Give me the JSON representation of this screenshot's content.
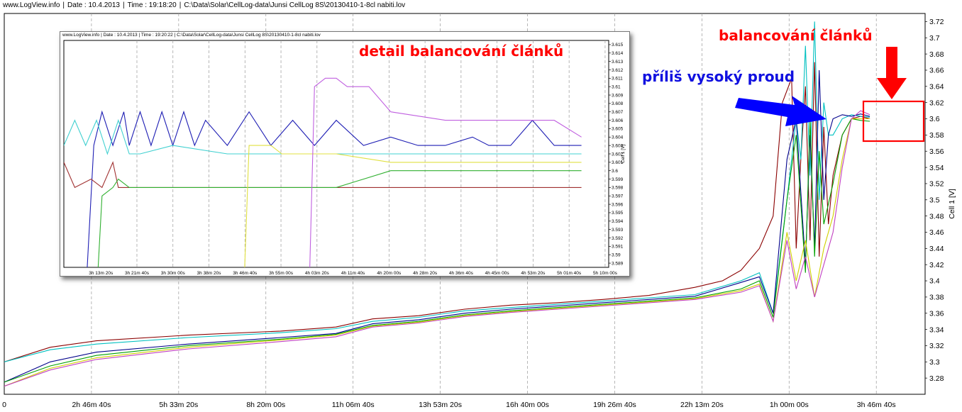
{
  "header": {
    "site": "www.LogView.info",
    "date": "Date : 10.4.2013",
    "time": "Time : 19:18:20",
    "path": "C:\\Data\\Solar\\CellLog-data\\Junsi CellLog 8S\\20130410-1-8cl nabiti.lov"
  },
  "annotations": {
    "detail": "detail balancování článků",
    "high_current": "příliš vysoký proud",
    "balancing": "balancování článků",
    "annotation_color": "#ff0000",
    "arrow_blue": "#0000ff"
  },
  "chart_data": [
    {
      "type": "line",
      "ylabel": "Cell 1 [V]",
      "ylim": [
        3.26,
        3.73
      ],
      "y_ticks": [
        "3.28",
        "3.3",
        "3.32",
        "3.34",
        "3.36",
        "3.38",
        "3.4",
        "3.42",
        "3.44",
        "3.46",
        "3.48",
        "3.5",
        "3.52",
        "3.54",
        "3.56",
        "3.58",
        "3.6",
        "3.62",
        "3.64",
        "3.66",
        "3.68",
        "3.7",
        "3.72"
      ],
      "x_ticks": [
        "0",
        "2h 46m 40s",
        "5h 33m 20s",
        "8h 20m 00s",
        "11h 06m 40s",
        "13h 53m 20s",
        "16h 40m 00s",
        "19h 26m 40s",
        "22h 13m 20s",
        "1h 00m 00s",
        "3h 46m 40s"
      ],
      "grid": true,
      "series": [
        {
          "color": "#8b0000",
          "x": [
            0,
            0.05,
            0.1,
            0.2,
            0.3,
            0.36,
            0.4,
            0.45,
            0.5,
            0.55,
            0.6,
            0.65,
            0.7,
            0.75,
            0.78,
            0.8,
            0.82,
            0.835,
            0.845,
            0.855,
            0.86,
            0.865,
            0.87,
            0.875,
            0.88,
            0.885,
            0.89,
            0.895,
            0.9,
            0.91,
            0.92,
            0.93,
            0.94
          ],
          "y": [
            3.3,
            3.318,
            3.326,
            3.333,
            3.338,
            3.343,
            3.353,
            3.357,
            3.365,
            3.37,
            3.373,
            3.377,
            3.382,
            3.392,
            3.4,
            3.413,
            3.44,
            3.48,
            3.62,
            3.65,
            3.44,
            3.55,
            3.64,
            3.45,
            3.67,
            3.43,
            3.59,
            3.47,
            3.53,
            3.58,
            3.6,
            3.603,
            3.6
          ]
        },
        {
          "color": "#00c0c0",
          "x": [
            0,
            0.05,
            0.1,
            0.2,
            0.3,
            0.36,
            0.4,
            0.45,
            0.5,
            0.55,
            0.6,
            0.65,
            0.7,
            0.75,
            0.8,
            0.82,
            0.835,
            0.85,
            0.86,
            0.865,
            0.87,
            0.875,
            0.88,
            0.885,
            0.89,
            0.895,
            0.9,
            0.91,
            0.92,
            0.93,
            0.94
          ],
          "y": [
            3.3,
            3.315,
            3.322,
            3.33,
            3.336,
            3.341,
            3.35,
            3.355,
            3.363,
            3.367,
            3.371,
            3.375,
            3.379,
            3.383,
            3.4,
            3.41,
            3.36,
            3.5,
            3.6,
            3.55,
            3.69,
            3.53,
            3.72,
            3.5,
            3.62,
            3.58,
            3.58,
            3.6,
            3.605,
            3.603,
            3.602
          ]
        },
        {
          "color": "#00008b",
          "x": [
            0,
            0.05,
            0.1,
            0.2,
            0.3,
            0.36,
            0.4,
            0.45,
            0.5,
            0.55,
            0.6,
            0.65,
            0.7,
            0.75,
            0.8,
            0.82,
            0.835,
            0.85,
            0.86,
            0.87,
            0.875,
            0.88,
            0.885,
            0.89,
            0.895,
            0.9,
            0.91,
            0.92,
            0.93,
            0.94
          ],
          "y": [
            3.275,
            3.3,
            3.312,
            3.322,
            3.33,
            3.335,
            3.347,
            3.352,
            3.36,
            3.365,
            3.369,
            3.373,
            3.377,
            3.381,
            3.398,
            3.405,
            3.36,
            3.55,
            3.6,
            3.42,
            3.58,
            3.44,
            3.66,
            3.5,
            3.58,
            3.6,
            3.605,
            3.603,
            3.606,
            3.603
          ]
        },
        {
          "color": "#00a000",
          "x": [
            0,
            0.05,
            0.1,
            0.2,
            0.3,
            0.36,
            0.4,
            0.45,
            0.5,
            0.55,
            0.6,
            0.65,
            0.7,
            0.75,
            0.8,
            0.82,
            0.835,
            0.85,
            0.86,
            0.87,
            0.875,
            0.88,
            0.885,
            0.89,
            0.9,
            0.91,
            0.92,
            0.93,
            0.94
          ],
          "y": [
            3.275,
            3.295,
            3.308,
            3.32,
            3.328,
            3.334,
            3.345,
            3.35,
            3.358,
            3.363,
            3.367,
            3.371,
            3.375,
            3.379,
            3.39,
            3.4,
            3.355,
            3.5,
            3.58,
            3.41,
            3.6,
            3.43,
            3.56,
            3.47,
            3.52,
            3.58,
            3.6,
            3.598,
            3.597
          ]
        },
        {
          "color": "#d0d000",
          "x": [
            0,
            0.05,
            0.1,
            0.2,
            0.3,
            0.36,
            0.4,
            0.45,
            0.5,
            0.55,
            0.6,
            0.65,
            0.7,
            0.75,
            0.8,
            0.82,
            0.835,
            0.85,
            0.86,
            0.87,
            0.88,
            0.89,
            0.9,
            0.91,
            0.92,
            0.93,
            0.94
          ],
          "y": [
            3.27,
            3.292,
            3.305,
            3.318,
            3.327,
            3.333,
            3.344,
            3.349,
            3.357,
            3.362,
            3.366,
            3.37,
            3.374,
            3.378,
            3.388,
            3.396,
            3.35,
            3.46,
            3.4,
            3.45,
            3.38,
            3.44,
            3.48,
            3.55,
            3.6,
            3.6,
            3.6
          ]
        },
        {
          "color": "#c040c0",
          "x": [
            0,
            0.05,
            0.1,
            0.2,
            0.3,
            0.36,
            0.4,
            0.45,
            0.5,
            0.55,
            0.6,
            0.65,
            0.7,
            0.75,
            0.8,
            0.82,
            0.835,
            0.85,
            0.86,
            0.87,
            0.88,
            0.89,
            0.9,
            0.91,
            0.92,
            0.93,
            0.94
          ],
          "y": [
            3.27,
            3.29,
            3.303,
            3.316,
            3.325,
            3.331,
            3.343,
            3.348,
            3.356,
            3.361,
            3.365,
            3.369,
            3.373,
            3.377,
            3.386,
            3.394,
            3.35,
            3.45,
            3.39,
            3.43,
            3.38,
            3.42,
            3.46,
            3.54,
            3.6,
            3.61,
            3.605
          ]
        }
      ]
    },
    {
      "type": "line",
      "ylabel": "Cell 1 [V]",
      "ylim": [
        3.5885,
        3.6155
      ],
      "y_ticks": [
        "3.589",
        "3.59",
        "3.591",
        "3.592",
        "3.593",
        "3.594",
        "3.595",
        "3.596",
        "3.597",
        "3.598",
        "3.599",
        "3.6",
        "3.601",
        "3.602",
        "3.603",
        "3.604",
        "3.605",
        "3.606",
        "3.607",
        "3.608",
        "3.609",
        "3.61",
        "3.611",
        "3.612",
        "3.613",
        "3.614",
        "3.615"
      ],
      "x_ticks": [
        "3h 13m 20s",
        "3h 21m 40s",
        "3h 30m 00s",
        "3h 38m 20s",
        "3h 46m 40s",
        "3h 55m 00s",
        "4h 03m 20s",
        "4h 11m 40s",
        "4h 20m 00s",
        "4h 28m 20s",
        "4h 36m 40s",
        "4h 45m 00s",
        "4h 53m 20s",
        "5h 01m 40s",
        "5h 10m 00s"
      ],
      "grid": true,
      "series": [
        {
          "color": "#1e1eb4",
          "x": [
            0,
            0.04,
            0.055,
            0.07,
            0.09,
            0.11,
            0.12,
            0.14,
            0.16,
            0.18,
            0.2,
            0.22,
            0.24,
            0.26,
            0.3,
            0.34,
            0.38,
            0.42,
            0.46,
            0.5,
            0.55,
            0.6,
            0.65,
            0.7,
            0.75,
            0.78,
            0.82,
            0.86,
            0.9,
            0.95
          ],
          "y": [
            3.585,
            3.585,
            3.603,
            3.607,
            3.603,
            3.607,
            3.603,
            3.607,
            3.603,
            3.607,
            3.603,
            3.607,
            3.603,
            3.606,
            3.603,
            3.607,
            3.603,
            3.606,
            3.603,
            3.606,
            3.603,
            3.604,
            3.603,
            3.603,
            3.604,
            3.603,
            3.603,
            3.606,
            3.603,
            3.603
          ]
        },
        {
          "color": "#40d0d0",
          "x": [
            0,
            0.02,
            0.04,
            0.06,
            0.08,
            0.1,
            0.12,
            0.14,
            0.2,
            0.3,
            0.4,
            0.5,
            0.6,
            0.7,
            0.8,
            0.9,
            0.95
          ],
          "y": [
            3.603,
            3.606,
            3.603,
            3.606,
            3.602,
            3.606,
            3.602,
            3.602,
            3.603,
            3.602,
            3.602,
            3.602,
            3.602,
            3.602,
            3.602,
            3.602,
            3.602
          ]
        },
        {
          "color": "#a03030",
          "x": [
            0,
            0.02,
            0.05,
            0.07,
            0.09,
            0.1,
            0.12,
            0.14,
            0.16,
            0.2,
            0.22,
            0.3,
            0.4,
            0.5,
            0.6,
            0.7,
            0.8,
            0.9,
            0.95
          ],
          "y": [
            3.601,
            3.598,
            3.599,
            3.598,
            3.601,
            3.598,
            3.598,
            3.598,
            3.598,
            3.598,
            3.598,
            3.598,
            3.598,
            3.598,
            3.598,
            3.598,
            3.598,
            3.598,
            3.598
          ]
        },
        {
          "color": "#30b030",
          "x": [
            0,
            0.06,
            0.07,
            0.09,
            0.1,
            0.12,
            0.14,
            0.2,
            0.3,
            0.4,
            0.5,
            0.6,
            0.7,
            0.8,
            0.9,
            0.95
          ],
          "y": [
            3.585,
            3.585,
            3.597,
            3.598,
            3.599,
            3.598,
            3.598,
            3.598,
            3.598,
            3.598,
            3.598,
            3.6,
            3.6,
            3.6,
            3.6,
            3.6
          ]
        },
        {
          "color": "#e0e040",
          "x": [
            0,
            0.33,
            0.34,
            0.36,
            0.38,
            0.4,
            0.5,
            0.6,
            0.7,
            0.8,
            0.95
          ],
          "y": [
            3.585,
            3.585,
            3.603,
            3.603,
            3.603,
            3.602,
            3.602,
            3.601,
            3.601,
            3.601,
            3.601
          ]
        },
        {
          "color": "#c060e0",
          "x": [
            0,
            0.45,
            0.46,
            0.48,
            0.5,
            0.52,
            0.54,
            0.56,
            0.6,
            0.7,
            0.8,
            0.9,
            0.95
          ],
          "y": [
            3.585,
            3.585,
            3.61,
            3.611,
            3.611,
            3.61,
            3.61,
            3.61,
            3.607,
            3.606,
            3.606,
            3.606,
            3.604
          ]
        }
      ]
    }
  ]
}
